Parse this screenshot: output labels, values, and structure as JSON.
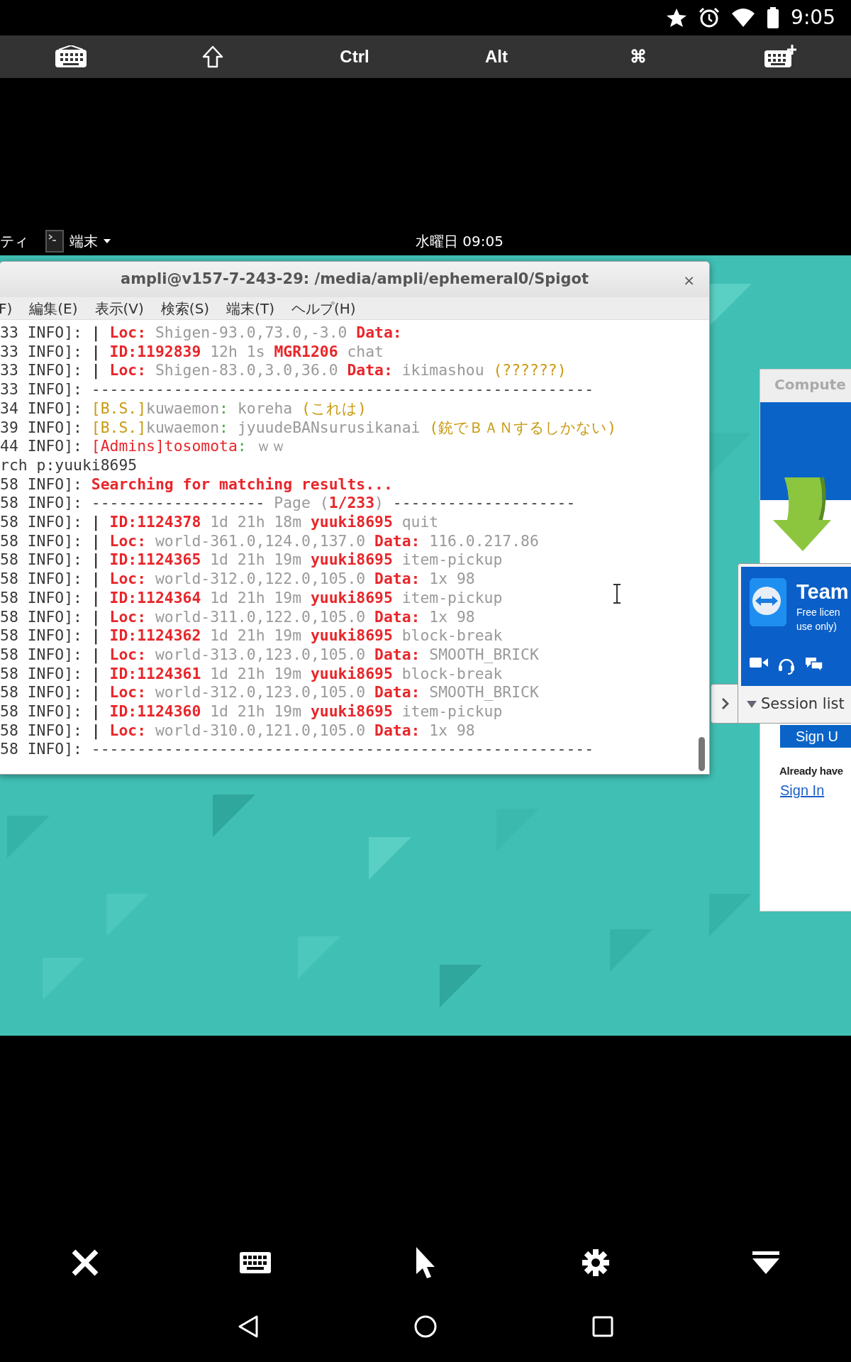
{
  "status_bar": {
    "time": "9:05"
  },
  "key_toolbar": [
    {
      "kind": "keyboard"
    },
    {
      "kind": "shift"
    },
    {
      "kind": "text",
      "label": "Ctrl"
    },
    {
      "kind": "text",
      "label": "Alt"
    },
    {
      "kind": "text",
      "label": "⌘"
    },
    {
      "kind": "keyboard-add"
    }
  ],
  "top_bar": {
    "activities": "ティ",
    "app_menu": "端末",
    "clock": "水曜日 09:05"
  },
  "terminal": {
    "title": "ampli@v157-7-243-29: /media/ampli/ephemeral0/Spigot",
    "close": "×",
    "menu": [
      "F)",
      "編集(E)",
      "表示(V)",
      "検索(S)",
      "端末(T)",
      "ヘルプ(H)"
    ],
    "lines": [
      [
        {
          "t": "33 INFO]: ",
          "kind": "plain"
        },
        {
          "t": "| ",
          "kind": "bar"
        },
        {
          "t": "Loc:",
          "kind": "key"
        },
        {
          "t": " Shigen-93.0,73.0,-3.0 ",
          "kind": "value"
        },
        {
          "t": "Data:",
          "kind": "key"
        }
      ],
      [
        {
          "t": "33 INFO]: ",
          "kind": "plain"
        },
        {
          "t": "| ",
          "kind": "bar"
        },
        {
          "t": "ID:1192839",
          "kind": "key"
        },
        {
          "t": " 12h 1s ",
          "kind": "value"
        },
        {
          "t": "MGR1206",
          "kind": "key"
        },
        {
          "t": " chat",
          "kind": "value"
        }
      ],
      [
        {
          "t": "33 INFO]: ",
          "kind": "plain"
        },
        {
          "t": "| ",
          "kind": "bar"
        },
        {
          "t": "Loc:",
          "kind": "key"
        },
        {
          "t": " Shigen-83.0,3.0,36.0 ",
          "kind": "value"
        },
        {
          "t": "Data:",
          "kind": "key"
        },
        {
          "t": " ikimashou ",
          "kind": "value"
        },
        {
          "t": "(??????)",
          "kind": "note"
        }
      ],
      [
        {
          "t": "33 INFO]: -------------------------------------------------------",
          "kind": "plain"
        }
      ],
      [
        {
          "t": "34 INFO]: ",
          "kind": "plain"
        },
        {
          "t": "[B.S.]",
          "kind": "note"
        },
        {
          "t": "kuwaemon",
          "kind": "value"
        },
        {
          "t": ":",
          "kind": "colon"
        },
        {
          "t": " koreha ",
          "kind": "value"
        },
        {
          "t": "(これは)",
          "kind": "note"
        }
      ],
      [
        {
          "t": "39 INFO]: ",
          "kind": "plain"
        },
        {
          "t": "[B.S.]",
          "kind": "note"
        },
        {
          "t": "kuwaemon",
          "kind": "value"
        },
        {
          "t": ":",
          "kind": "colon"
        },
        {
          "t": " jyuudeBANsurusikanai ",
          "kind": "value"
        },
        {
          "t": "(銃でＢＡＮするしかない)",
          "kind": "note"
        }
      ],
      [
        {
          "t": "44 INFO]: ",
          "kind": "plain"
        },
        {
          "t": "[Admins]tosomota",
          "kind": "name"
        },
        {
          "t": ":",
          "kind": "colon"
        },
        {
          "t": " ｗｗ",
          "kind": "value"
        }
      ],
      [
        {
          "t": "rch p:yuuki8695",
          "kind": "plain"
        }
      ],
      [
        {
          "t": "58 INFO]: ",
          "kind": "plain"
        },
        {
          "t": "Searching for matching results...",
          "kind": "key"
        }
      ],
      [
        {
          "t": "58 INFO]: ------------------- ",
          "kind": "plain"
        },
        {
          "t": "Page (",
          "kind": "value"
        },
        {
          "t": "1/233",
          "kind": "key"
        },
        {
          "t": ")",
          "kind": "value"
        },
        {
          "t": " --------------------",
          "kind": "plain"
        }
      ],
      [
        {
          "t": "58 INFO]: ",
          "kind": "plain"
        },
        {
          "t": "| ",
          "kind": "bar"
        },
        {
          "t": "ID:1124378",
          "kind": "key"
        },
        {
          "t": " 1d 21h 18m ",
          "kind": "value"
        },
        {
          "t": "yuuki8695",
          "kind": "key"
        },
        {
          "t": " quit",
          "kind": "value"
        }
      ],
      [
        {
          "t": "58 INFO]: ",
          "kind": "plain"
        },
        {
          "t": "| ",
          "kind": "bar"
        },
        {
          "t": "Loc:",
          "kind": "key"
        },
        {
          "t": " world-361.0,124.0,137.0 ",
          "kind": "value"
        },
        {
          "t": "Data:",
          "kind": "key"
        },
        {
          "t": " 116.0.217.86",
          "kind": "value"
        }
      ],
      [
        {
          "t": "58 INFO]: ",
          "kind": "plain"
        },
        {
          "t": "| ",
          "kind": "bar"
        },
        {
          "t": "ID:1124365",
          "kind": "key"
        },
        {
          "t": " 1d 21h 19m ",
          "kind": "value"
        },
        {
          "t": "yuuki8695",
          "kind": "key"
        },
        {
          "t": " item-pickup",
          "kind": "value"
        }
      ],
      [
        {
          "t": "58 INFO]: ",
          "kind": "plain"
        },
        {
          "t": "| ",
          "kind": "bar"
        },
        {
          "t": "Loc:",
          "kind": "key"
        },
        {
          "t": " world-312.0,122.0,105.0 ",
          "kind": "value"
        },
        {
          "t": "Data:",
          "kind": "key"
        },
        {
          "t": " 1x 98",
          "kind": "value"
        }
      ],
      [
        {
          "t": "58 INFO]: ",
          "kind": "plain"
        },
        {
          "t": "| ",
          "kind": "bar"
        },
        {
          "t": "ID:1124364",
          "kind": "key"
        },
        {
          "t": " 1d 21h 19m ",
          "kind": "value"
        },
        {
          "t": "yuuki8695",
          "kind": "key"
        },
        {
          "t": " item-pickup",
          "kind": "value"
        }
      ],
      [
        {
          "t": "58 INFO]: ",
          "kind": "plain"
        },
        {
          "t": "| ",
          "kind": "bar"
        },
        {
          "t": "Loc:",
          "kind": "key"
        },
        {
          "t": " world-311.0,122.0,105.0 ",
          "kind": "value"
        },
        {
          "t": "Data:",
          "kind": "key"
        },
        {
          "t": " 1x 98",
          "kind": "value"
        }
      ],
      [
        {
          "t": "58 INFO]: ",
          "kind": "plain"
        },
        {
          "t": "| ",
          "kind": "bar"
        },
        {
          "t": "ID:1124362",
          "kind": "key"
        },
        {
          "t": " 1d 21h 19m ",
          "kind": "value"
        },
        {
          "t": "yuuki8695",
          "kind": "key"
        },
        {
          "t": " block-break",
          "kind": "value"
        }
      ],
      [
        {
          "t": "58 INFO]: ",
          "kind": "plain"
        },
        {
          "t": "| ",
          "kind": "bar"
        },
        {
          "t": "Loc:",
          "kind": "key"
        },
        {
          "t": " world-313.0,123.0,105.0 ",
          "kind": "value"
        },
        {
          "t": "Data:",
          "kind": "key"
        },
        {
          "t": " SMOOTH_BRICK",
          "kind": "value"
        }
      ],
      [
        {
          "t": "58 INFO]: ",
          "kind": "plain"
        },
        {
          "t": "| ",
          "kind": "bar"
        },
        {
          "t": "ID:1124361",
          "kind": "key"
        },
        {
          "t": " 1d 21h 19m ",
          "kind": "value"
        },
        {
          "t": "yuuki8695",
          "kind": "key"
        },
        {
          "t": " block-break",
          "kind": "value"
        }
      ],
      [
        {
          "t": "58 INFO]: ",
          "kind": "plain"
        },
        {
          "t": "| ",
          "kind": "bar"
        },
        {
          "t": "Loc:",
          "kind": "key"
        },
        {
          "t": " world-312.0,123.0,105.0 ",
          "kind": "value"
        },
        {
          "t": "Data:",
          "kind": "key"
        },
        {
          "t": " SMOOTH_BRICK",
          "kind": "value"
        }
      ],
      [
        {
          "t": "58 INFO]: ",
          "kind": "plain"
        },
        {
          "t": "| ",
          "kind": "bar"
        },
        {
          "t": "ID:1124360",
          "kind": "key"
        },
        {
          "t": " 1d 21h 19m ",
          "kind": "value"
        },
        {
          "t": "yuuki8695",
          "kind": "key"
        },
        {
          "t": " item-pickup",
          "kind": "value"
        }
      ],
      [
        {
          "t": "58 INFO]: ",
          "kind": "plain"
        },
        {
          "t": "| ",
          "kind": "bar"
        },
        {
          "t": "Loc:",
          "kind": "key"
        },
        {
          "t": " world-310.0,121.0,105.0 ",
          "kind": "value"
        },
        {
          "t": "Data:",
          "kind": "key"
        },
        {
          "t": " 1x 98",
          "kind": "value"
        }
      ],
      [
        {
          "t": "58 INFO]: -------------------------------------------------------",
          "kind": "plain"
        }
      ]
    ]
  },
  "web_page": {
    "header": "Compute",
    "sign_up": "Sign U",
    "already": "Already have",
    "sign_in": "Sign In"
  },
  "teamviewer": {
    "title": "Team",
    "subtitle": [
      "Free licen",
      "use only)"
    ],
    "session_list": "Session list"
  }
}
